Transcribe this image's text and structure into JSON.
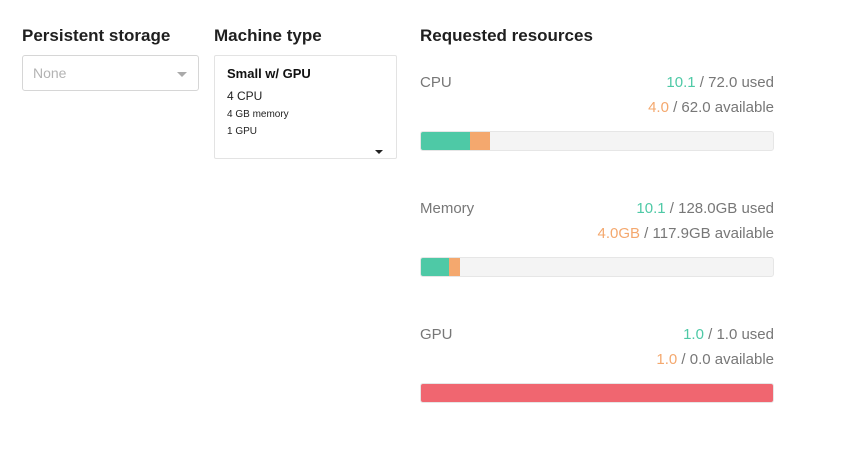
{
  "storage": {
    "title": "Persistent storage",
    "placeholder": "None"
  },
  "machine": {
    "title": "Machine type",
    "name": "Small w/ GPU",
    "cpu": "4 CPU",
    "memory": "4 GB memory",
    "gpu": "1 GPU"
  },
  "resources": {
    "title": "Requested resources",
    "cpu": {
      "label": "CPU",
      "used_value": "10.1",
      "used_rest": " / 72.0 used",
      "avail_value": "4.0",
      "avail_rest": " / 62.0 available",
      "used_fraction": 0.14,
      "requested_fraction": 0.055
    },
    "memory": {
      "label": "Memory",
      "used_value": "10.1",
      "used_rest": " / 128.0GB used",
      "avail_value": "4.0GB",
      "avail_rest": " / 117.9GB available",
      "used_fraction": 0.079,
      "requested_fraction": 0.031
    },
    "gpu": {
      "label": "GPU",
      "used_value": "1.0",
      "used_rest": " / 1.0 used",
      "avail_value": "1.0",
      "avail_rest": " / 0.0 available",
      "over_fraction": 1.0
    }
  },
  "colors": {
    "used": "#4ec9a6",
    "requested": "#f4a86e",
    "over": "#f06670"
  }
}
